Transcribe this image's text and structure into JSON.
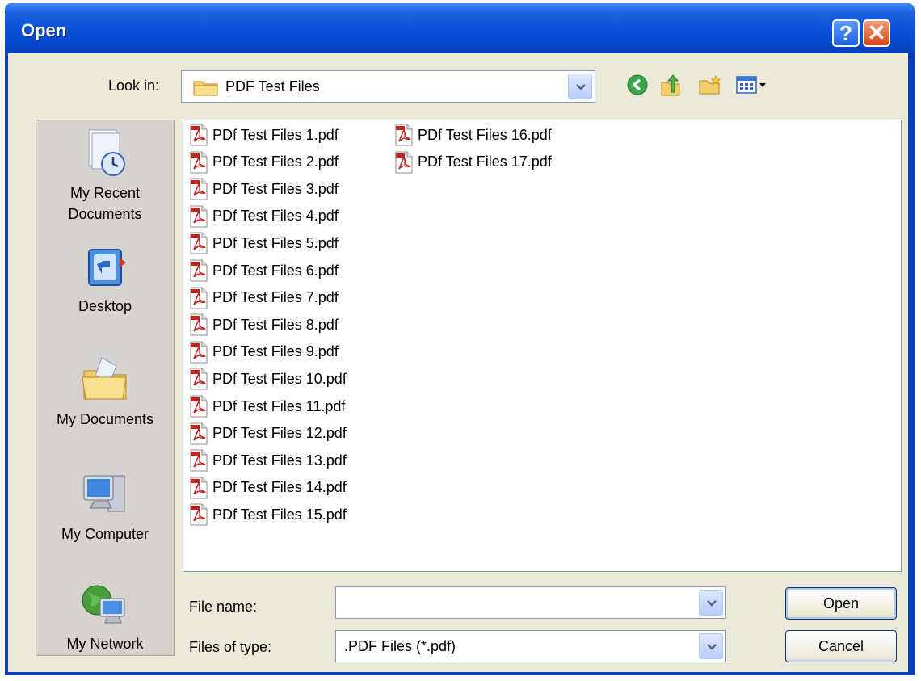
{
  "window": {
    "title": "Open"
  },
  "title_buttons": {
    "help": "?",
    "close": "✕"
  },
  "lookin": {
    "label": "Look in:",
    "value": "PDF Test Files"
  },
  "toolbar": [
    "back-icon",
    "up-folder-icon",
    "new-folder-icon",
    "view-menu-icon"
  ],
  "places": [
    {
      "label": "My Recent Documents",
      "icon": "recent-documents-icon"
    },
    {
      "label": "Desktop",
      "icon": "desktop-icon"
    },
    {
      "label": "My Documents",
      "icon": "my-documents-icon"
    },
    {
      "label": "My Computer",
      "icon": "my-computer-icon"
    },
    {
      "label": "My Network",
      "icon": "my-network-icon"
    }
  ],
  "files": [
    "PDf Test Files 1.pdf",
    "PDf Test Files 2.pdf",
    "PDf Test Files 3.pdf",
    "PDf Test Files 4.pdf",
    "PDf Test Files 5.pdf",
    "PDf Test Files 6.pdf",
    "PDf Test Files 7.pdf",
    "PDf Test Files 8.pdf",
    "PDf Test Files 9.pdf",
    "PDf Test Files 10.pdf",
    "PDf Test Files 11.pdf",
    "PDf Test Files 12.pdf",
    "PDf Test Files 13.pdf",
    "PDf Test Files 14.pdf",
    "PDf Test Files 15.pdf",
    "PDf Test Files 16.pdf",
    "PDf Test Files 17.pdf"
  ],
  "filename": {
    "label": "File name:",
    "value": ""
  },
  "filetype": {
    "label": "Files of type:",
    "value": ".PDF Files (*.pdf)"
  },
  "buttons": {
    "open": "Open",
    "cancel": "Cancel"
  }
}
